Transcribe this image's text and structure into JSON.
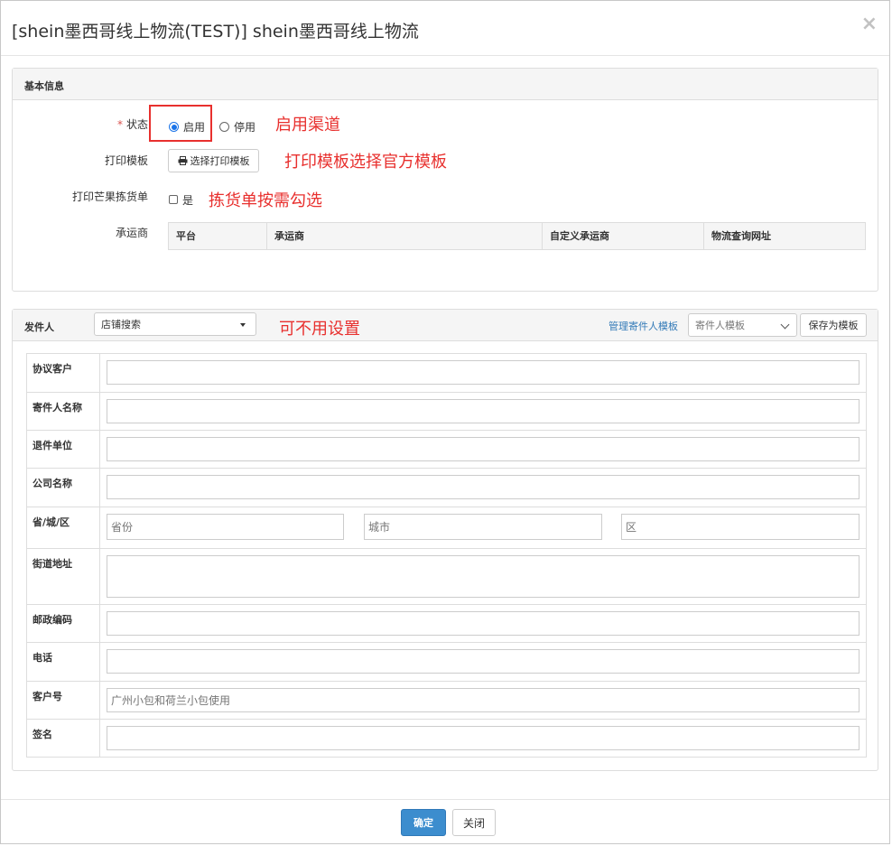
{
  "modal": {
    "title": "[shein墨西哥线上物流(TEST)] shein墨西哥线上物流",
    "close_symbol": "×"
  },
  "basic": {
    "title": "基本信息",
    "status_label": "状态",
    "required_mark": "*",
    "status_options": [
      "启用",
      "停用"
    ],
    "status_selected": "启用",
    "print_template_label": "打印模板",
    "print_template_button": "选择打印模板",
    "mango_label": "打印芒果拣货单",
    "mango_option": "是",
    "carrier_label": "承运商",
    "carrier_columns": [
      "平台",
      "承运商",
      "自定义承运商",
      "物流查询网址"
    ]
  },
  "annotations": {
    "status": "启用渠道",
    "print_template": "打印模板选择官方模板",
    "picking": "拣货单按需勾选",
    "sender": "可不用设置"
  },
  "sender": {
    "title": "发件人",
    "search_select": "店铺搜索",
    "manage_link": "管理寄件人模板",
    "template_select": "寄件人模板",
    "save_button": "保存为模板",
    "rows": [
      {
        "label": "协议客户",
        "value": ""
      },
      {
        "label": "寄件人名称",
        "value": ""
      },
      {
        "label": "退件单位",
        "value": ""
      },
      {
        "label": "公司名称",
        "value": ""
      },
      {
        "label": "省/城/区",
        "placeholders": [
          "省份",
          "城市",
          "区"
        ]
      },
      {
        "label": "街道地址",
        "value": ""
      },
      {
        "label": "邮政编码",
        "value": ""
      },
      {
        "label": "电话",
        "value": ""
      },
      {
        "label": "客户号",
        "placeholder": "广州小包和荷兰小包使用"
      },
      {
        "label": "签名",
        "value": ""
      }
    ]
  },
  "footer": {
    "confirm": "确定",
    "close": "关闭"
  },
  "colors": {
    "accent_blue": "#3c8dce",
    "link_blue": "#337ab7",
    "annotation_red": "#e8302e"
  }
}
